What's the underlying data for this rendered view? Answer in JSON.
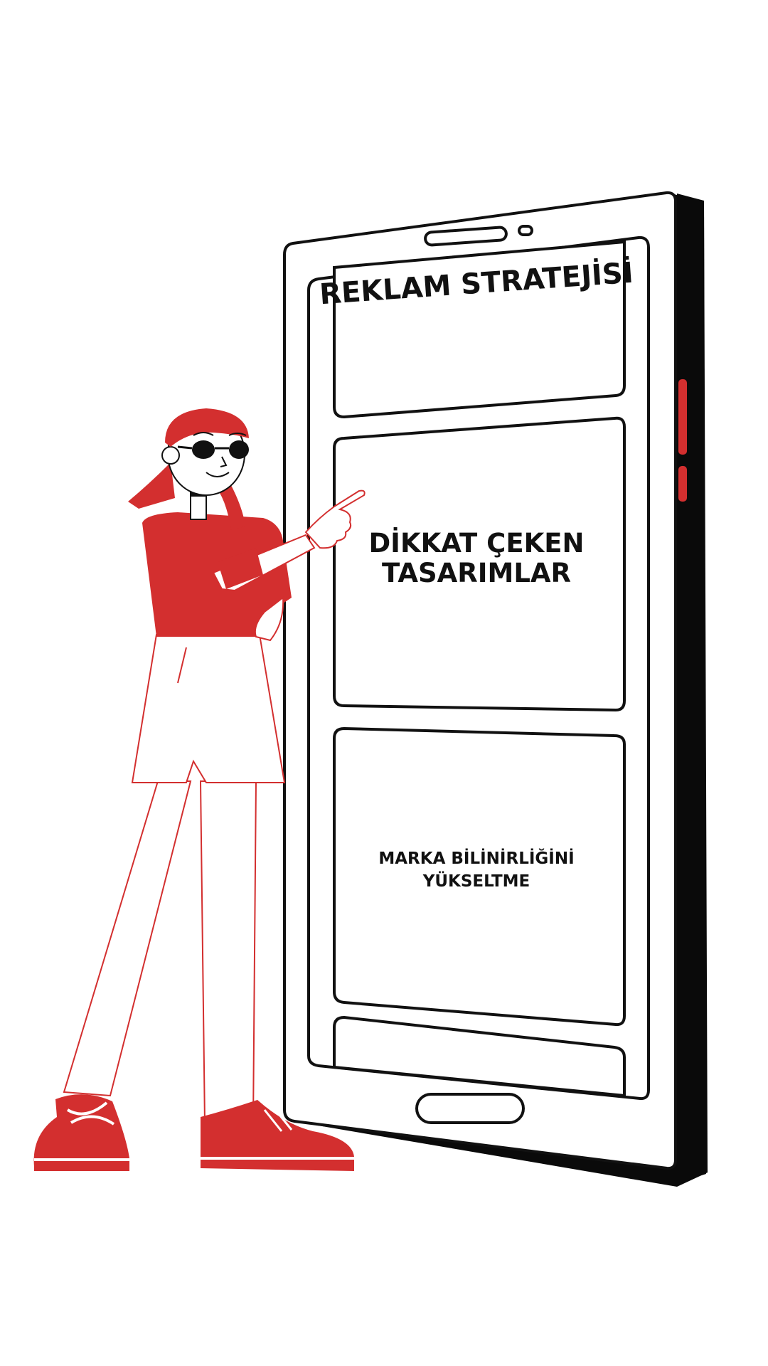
{
  "screens": {
    "top_title": "REKLAM STRATEJİSİ",
    "middle_line1": "DİKKAT ÇEKEN",
    "middle_line2": "TASARIMLAR",
    "bottom_line1": "MARKA BİLİNİRLİĞİNİ",
    "bottom_line2": "YÜKSELTME"
  },
  "colors": {
    "accent": "#d32f2f",
    "outline": "#111111",
    "background": "#ffffff"
  },
  "icons": {
    "character": "woman-pointing-illustration",
    "device": "smartphone-illustration"
  }
}
